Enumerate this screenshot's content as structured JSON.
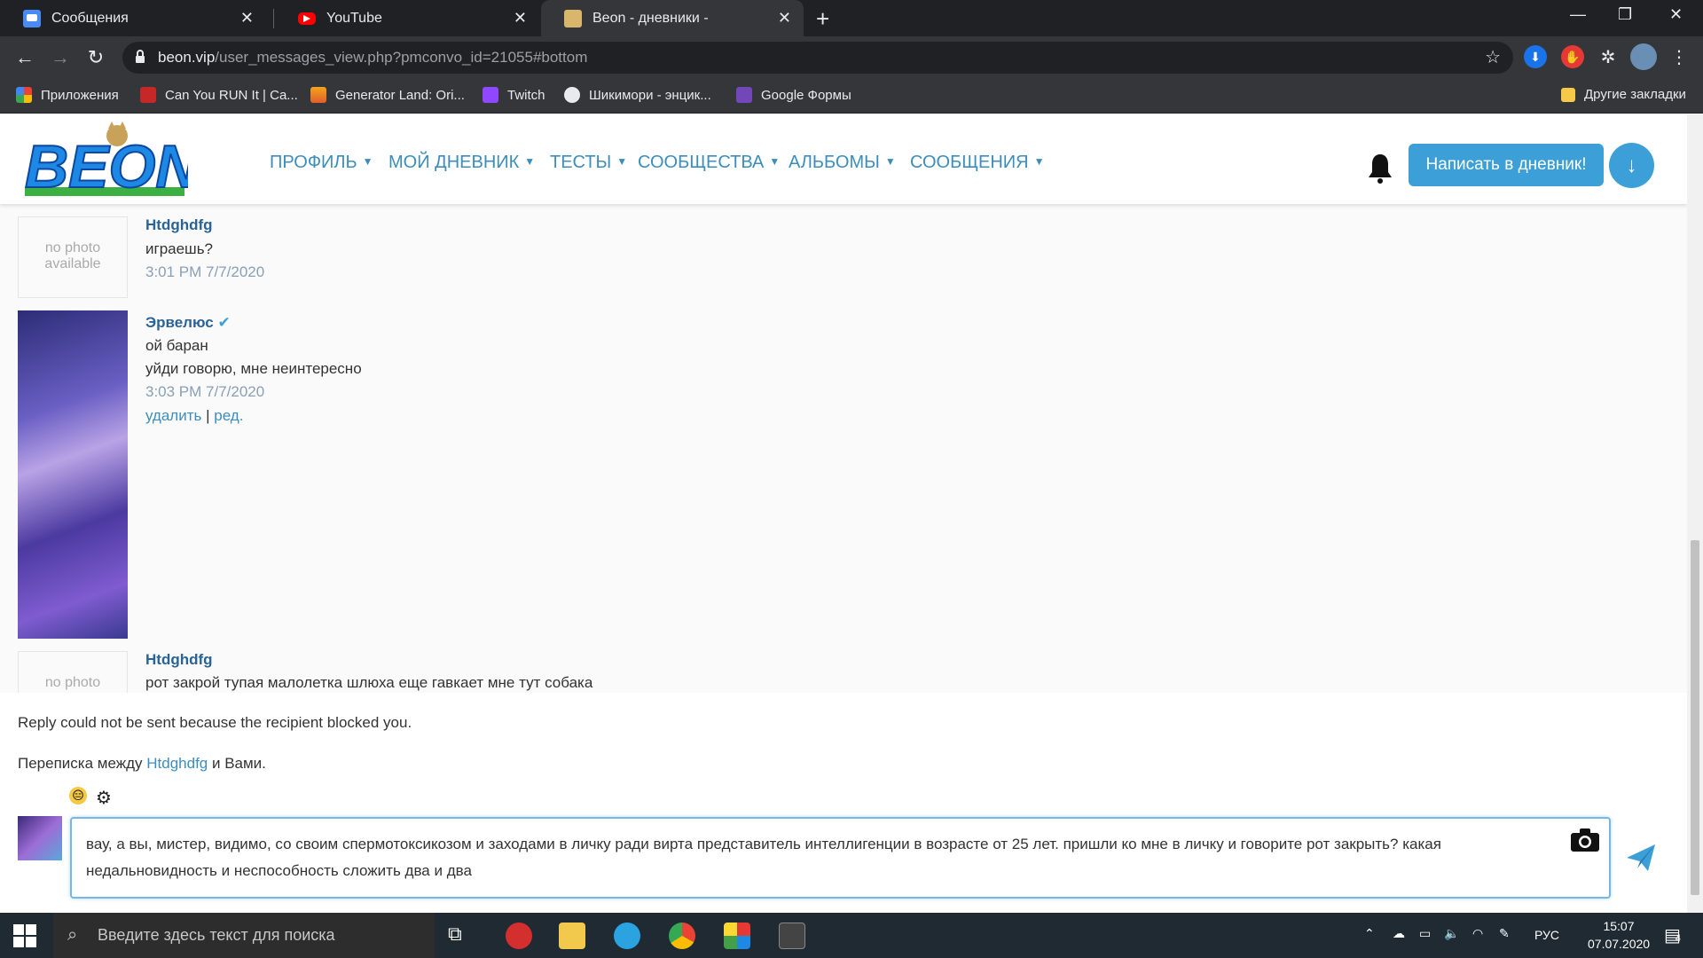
{
  "browser": {
    "tabs": [
      {
        "title": "Сообщения",
        "active": false
      },
      {
        "title": "YouTube",
        "active": false
      },
      {
        "title": "Beon - дневники -",
        "active": true
      }
    ],
    "url_host": "beon.vip",
    "url_path": "/user_messages_view.php?pmconvo_id=21055#bottom",
    "bookmarks": [
      "Приложения",
      "Can You RUN It | Ca...",
      "Generator Land: Ori...",
      "Twitch",
      "Шикимори - энцик...",
      "Google Формы"
    ],
    "other_bookmarks": "Другие закладки"
  },
  "header": {
    "logo_text": "BEON",
    "menu": [
      "ПРОФИЛЬ",
      "МОЙ ДНЕВНИК",
      "ТЕСТЫ",
      "СООБЩЕСТВА",
      "АЛЬБОМЫ",
      "СООБЩЕНИЯ"
    ],
    "write_button": "Написать в дневник!"
  },
  "messages": [
    {
      "author": "Htdghdfg",
      "avatar_text": "no photo available",
      "lines": [
        "играешь?"
      ],
      "time": "3:01 PM 7/7/2020"
    },
    {
      "author": "Эрвелюс",
      "verified": true,
      "lines": [
        "ой баран",
        "уйди говорю, мне неинтересно"
      ],
      "time": "3:03 PM 7/7/2020",
      "actions": [
        "удалить",
        "ред."
      ]
    },
    {
      "author": "Htdghdfg",
      "avatar_text": "no photo",
      "lines": [
        "рот закрой тупая малолетка шлюха еще гавкает мне тут собака"
      ]
    }
  ],
  "status": "Reply could not be sent because the recipient blocked you.",
  "between": {
    "prefix": "Переписка между",
    "user": "Htdghdfg",
    "suffix": "и Вами."
  },
  "reply": {
    "text": "вау, а вы, мистер, видимо, со своим спермотоксикозом и заходами в личку ради вирта представитель интеллигенции в возрасте от 25 лет. пришли ко мне в личку и говорите рот закрыть? какая недальновидность и неспособность сложить два и два"
  },
  "taskbar": {
    "search_placeholder": "Введите здесь текст для поиска",
    "lang": "РУС",
    "time": "15:07",
    "date": "07.07.2020",
    "notif_count": "4"
  }
}
